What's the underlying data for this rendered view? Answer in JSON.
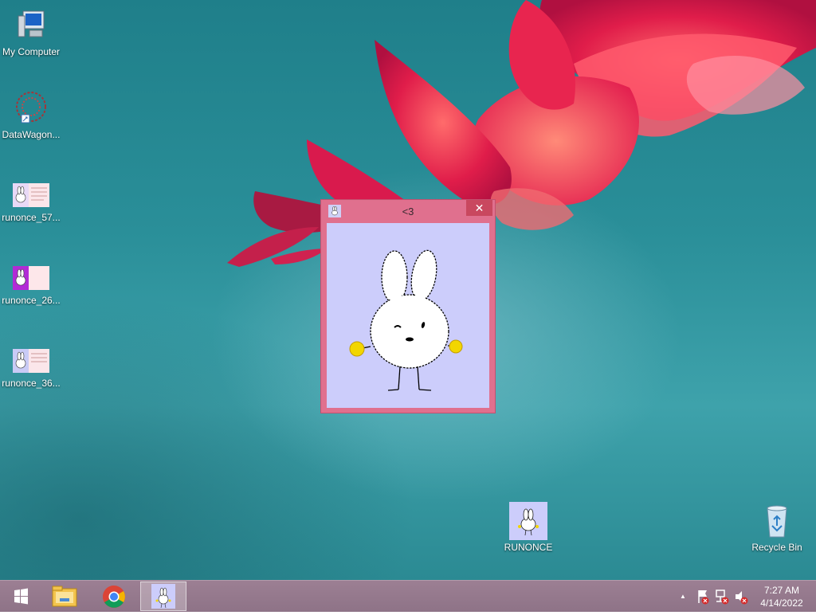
{
  "desktop": {
    "icons": [
      {
        "label": "My Computer",
        "icon": "computer-icon"
      },
      {
        "label": "DataWagon...",
        "icon": "datawagon-shortcut-icon"
      },
      {
        "label": "runonce_57...",
        "icon": "bunny-image-icon"
      },
      {
        "label": "runonce_26...",
        "icon": "bunny-image-icon"
      },
      {
        "label": "runonce_36...",
        "icon": "bunny-image-icon"
      },
      {
        "label": "RUNONCE",
        "icon": "bunny-app-icon"
      },
      {
        "label": "Recycle Bin",
        "icon": "recycle-bin-icon"
      }
    ]
  },
  "window": {
    "title": "<3",
    "close_glyph": "✕",
    "accent": "#e0708e",
    "client_bg": "#cccdfb"
  },
  "taskbar": {
    "start": "windows-logo-icon",
    "pinned": [
      "file-explorer-icon",
      "chrome-icon",
      "bunny-app-icon"
    ],
    "tray": {
      "chevron": "▲",
      "time": "7:27 AM",
      "date": "4/14/2022"
    }
  }
}
